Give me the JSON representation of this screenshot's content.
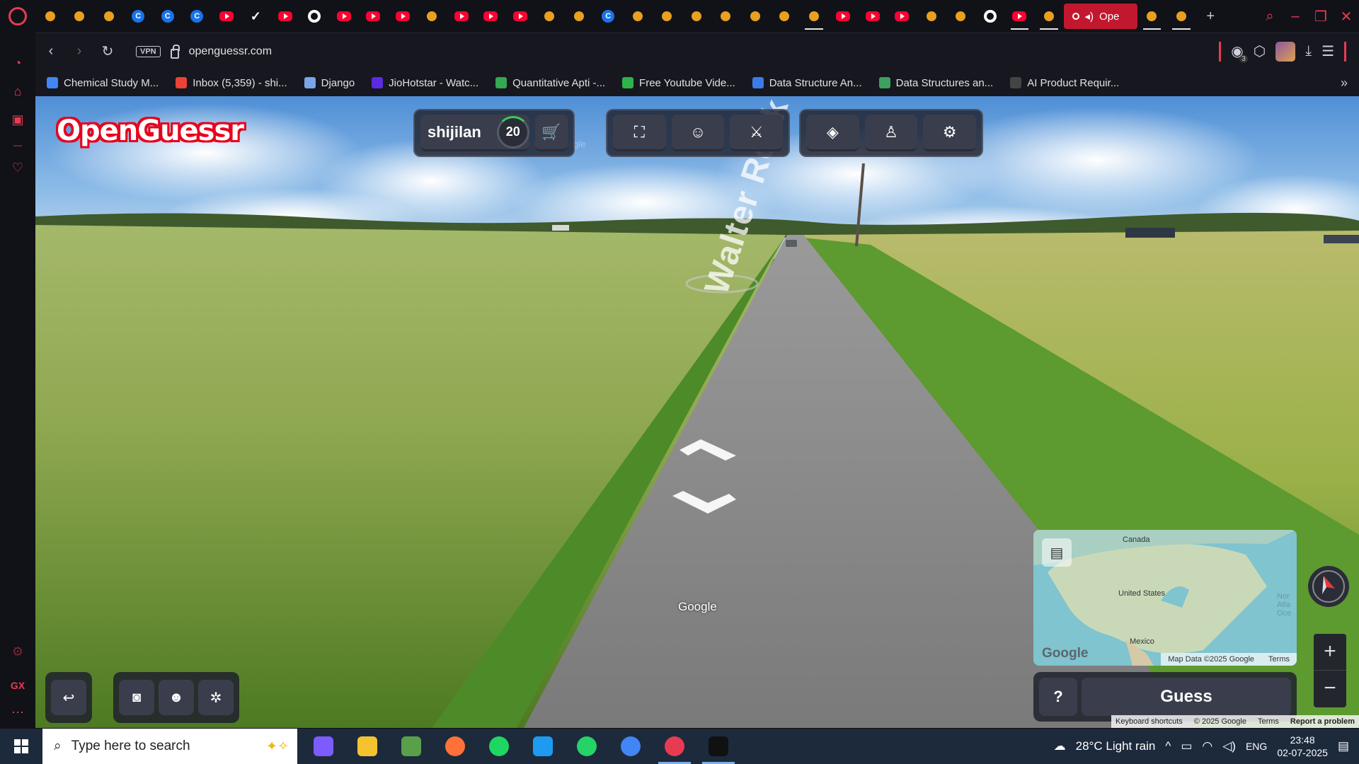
{
  "browser": {
    "tabs": [
      {
        "type": "game",
        "icon": "gamepad-icon"
      },
      {
        "type": "other",
        "icon": "bolt-icon"
      },
      {
        "type": "other",
        "icon": "bolt-icon"
      },
      {
        "type": "c",
        "icon": "c-icon"
      },
      {
        "type": "c",
        "icon": "c-icon"
      },
      {
        "type": "c",
        "icon": "c-icon"
      },
      {
        "type": "yt",
        "icon": "youtube-icon"
      },
      {
        "type": "check",
        "icon": "check-icon"
      },
      {
        "type": "yt",
        "icon": "youtube-icon"
      },
      {
        "type": "gh",
        "icon": "github-icon"
      },
      {
        "type": "yt",
        "icon": "youtube-icon"
      },
      {
        "type": "yt",
        "icon": "youtube-icon"
      },
      {
        "type": "yt",
        "icon": "youtube-icon"
      },
      {
        "type": "openai",
        "icon": "openai-icon"
      },
      {
        "type": "yt",
        "icon": "youtube-icon"
      },
      {
        "type": "yt",
        "icon": "youtube-icon"
      },
      {
        "type": "yt",
        "icon": "youtube-icon"
      },
      {
        "type": "other",
        "icon": "eye-icon"
      },
      {
        "type": "other",
        "icon": "eye-icon"
      },
      {
        "type": "c",
        "icon": "c-icon"
      },
      {
        "type": "other",
        "icon": "dribbble-icon"
      },
      {
        "type": "other",
        "icon": "drive-icon"
      },
      {
        "type": "other",
        "icon": "triangle-icon"
      },
      {
        "type": "other",
        "icon": "link-icon"
      },
      {
        "type": "other",
        "icon": "bolt-icon"
      },
      {
        "type": "other",
        "icon": "flame-icon"
      },
      {
        "type": "sel",
        "icon": "butterfly-icon"
      },
      {
        "type": "yt",
        "icon": "youtube-icon"
      },
      {
        "type": "yt",
        "icon": "youtube-icon"
      },
      {
        "type": "yt",
        "icon": "youtube-icon"
      },
      {
        "type": "other",
        "icon": "k-icon"
      },
      {
        "type": "other",
        "icon": "shield-icon"
      },
      {
        "type": "gh",
        "icon": "github-icon"
      },
      {
        "type": "yt-sel",
        "icon": "youtube-icon"
      },
      {
        "type": "sel",
        "icon": "vue-icon"
      }
    ],
    "active_tab_label": "Ope",
    "tabs_after": [
      {
        "type": "sel",
        "icon": "leaf-icon"
      },
      {
        "type": "sel",
        "icon": "dribbble-icon"
      }
    ],
    "new_tab": "+",
    "url": "openguessr.com",
    "vpn": "VPN",
    "extensions_badge": "3",
    "bookmarks": [
      {
        "label": "Chemical Study M...",
        "color": "#4285f4"
      },
      {
        "label": "Inbox (5,359) - shi...",
        "color": "#ea4335"
      },
      {
        "label": "Django",
        "color": "#7aa6e8"
      },
      {
        "label": "JioHotstar - Watc...",
        "color": "#5b2be0"
      },
      {
        "label": "Quantitative Apti -...",
        "color": "#34a853"
      },
      {
        "label": "Free Youtube Vide...",
        "color": "#2fb24a"
      },
      {
        "label": "Data Structure An...",
        "color": "#3b7be8"
      },
      {
        "label": "Data Structures an...",
        "color": "#3ca060"
      },
      {
        "label": "AI Product Requir...",
        "color": "#444444"
      }
    ]
  },
  "sidebar": {
    "items": [
      "speed-dial-icon",
      "bag-icon",
      "calendar-icon",
      "divider",
      "heart-icon"
    ],
    "bottom": [
      "extension-icon",
      "GX",
      "more-icon"
    ]
  },
  "game": {
    "logo": "OpenGuessr",
    "username": "shijilan",
    "level": "20",
    "street_sign": "Walter Rock Rd",
    "map": {
      "labels": {
        "canada": "Canada",
        "us": "United States",
        "mexico": "Mexico",
        "atlantic": "Nor Atla Oce"
      },
      "google": "Google",
      "map_data": "Map Data ©2025 Google",
      "terms": "Terms"
    },
    "help": "?",
    "guess": "Guess",
    "watermark": "Google",
    "faint_copyright": "© 2024 Google",
    "footer": {
      "keyboard": "Keyboard shortcuts",
      "copyright": "© 2025 Google",
      "terms": "Terms",
      "report": "Report a problem"
    },
    "zoom_in": "+",
    "zoom_out": "−"
  },
  "taskbar": {
    "search_placeholder": "Type here to search",
    "weather": "28°C  Light rain",
    "language": "ENG",
    "time": "23:48",
    "date": "02-07-2025",
    "apps": [
      {
        "name": "copilot-icon",
        "color": "#7c5cff"
      },
      {
        "name": "file-explorer-icon",
        "color": "#f4c430"
      },
      {
        "name": "notepad-icon",
        "color": "#5aa04a"
      },
      {
        "name": "firefox-icon",
        "color": "#ff7139"
      },
      {
        "name": "spotify-icon",
        "color": "#1ed760"
      },
      {
        "name": "twitter-icon",
        "color": "#1d9bf0"
      },
      {
        "name": "whatsapp-icon",
        "color": "#25d366"
      },
      {
        "name": "chrome-icon",
        "color": "#4285f4"
      },
      {
        "name": "opera-gx-icon",
        "color": "#e83b52"
      },
      {
        "name": "capcut-icon",
        "color": "#111111"
      }
    ]
  }
}
